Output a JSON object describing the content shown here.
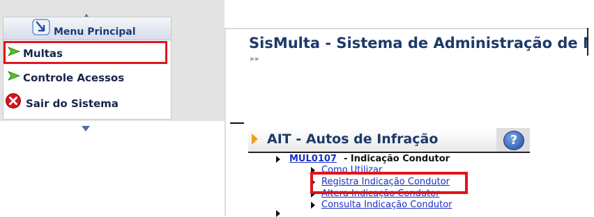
{
  "menu": {
    "title": "Menu Principal",
    "items": [
      {
        "label": "Multas",
        "icon": "green-arrow-icon",
        "highlighted": true
      },
      {
        "label": "Controle Acessos",
        "icon": "green-arrow-icon"
      },
      {
        "label": "Sair do Sistema",
        "icon": "red-x-icon"
      }
    ]
  },
  "header": {
    "app_title": "SisMulta - Sistema de Administração de M",
    "chevrons": "»»"
  },
  "section": {
    "title": "AIT - Autos de Infração",
    "help_symbol": "?"
  },
  "module": {
    "code": "MUL0107",
    "description": "- Indicação Condutor",
    "links": [
      {
        "label": "Como Utilizar"
      },
      {
        "label": "Registra Indicação Condutor",
        "highlighted": true
      },
      {
        "label": "Altera Indicação Condutor"
      },
      {
        "label": "Consulta Indicação Condutor"
      }
    ]
  },
  "colors": {
    "highlight": "#e0141c",
    "link": "#1a2fc4",
    "title": "#1c3a6a",
    "accent_arrow": "#f39a1e"
  }
}
